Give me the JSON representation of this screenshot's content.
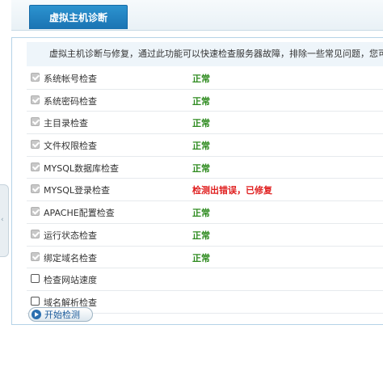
{
  "header": {
    "title": "虚拟主机诊断"
  },
  "description": "虚拟主机诊断与修复，通过此功能可以快速检查服务器故障，排除一些常见问题，您可",
  "checks": [
    {
      "label": "系统帐号检查",
      "status": "正常",
      "status_type": "ok",
      "checked": true
    },
    {
      "label": "系统密码检查",
      "status": "正常",
      "status_type": "ok",
      "checked": true
    },
    {
      "label": "主目录检查",
      "status": "正常",
      "status_type": "ok",
      "checked": true
    },
    {
      "label": "文件权限检查",
      "status": "正常",
      "status_type": "ok",
      "checked": true
    },
    {
      "label": "MYSQL数据库检查",
      "status": "正常",
      "status_type": "ok",
      "checked": true
    },
    {
      "label": "MYSQL登录检查",
      "status": "检测出错误，已修复",
      "status_type": "err",
      "checked": true
    },
    {
      "label": "APACHE配置检查",
      "status": "正常",
      "status_type": "ok",
      "checked": true
    },
    {
      "label": "运行状态检查",
      "status": "正常",
      "status_type": "ok",
      "checked": true
    },
    {
      "label": "绑定域名检查",
      "status": "正常",
      "status_type": "ok",
      "checked": true
    },
    {
      "label": "检查网站速度",
      "status": "",
      "status_type": "",
      "checked": false
    },
    {
      "label": "域名解析检查",
      "status": "",
      "status_type": "",
      "checked": false
    }
  ],
  "start_button": {
    "label": "开始检测"
  },
  "side_tab": {
    "glyph": "‹"
  },
  "colors": {
    "ok": "#2e8b1f",
    "error": "#e02020",
    "accent": "#1a73b3"
  }
}
